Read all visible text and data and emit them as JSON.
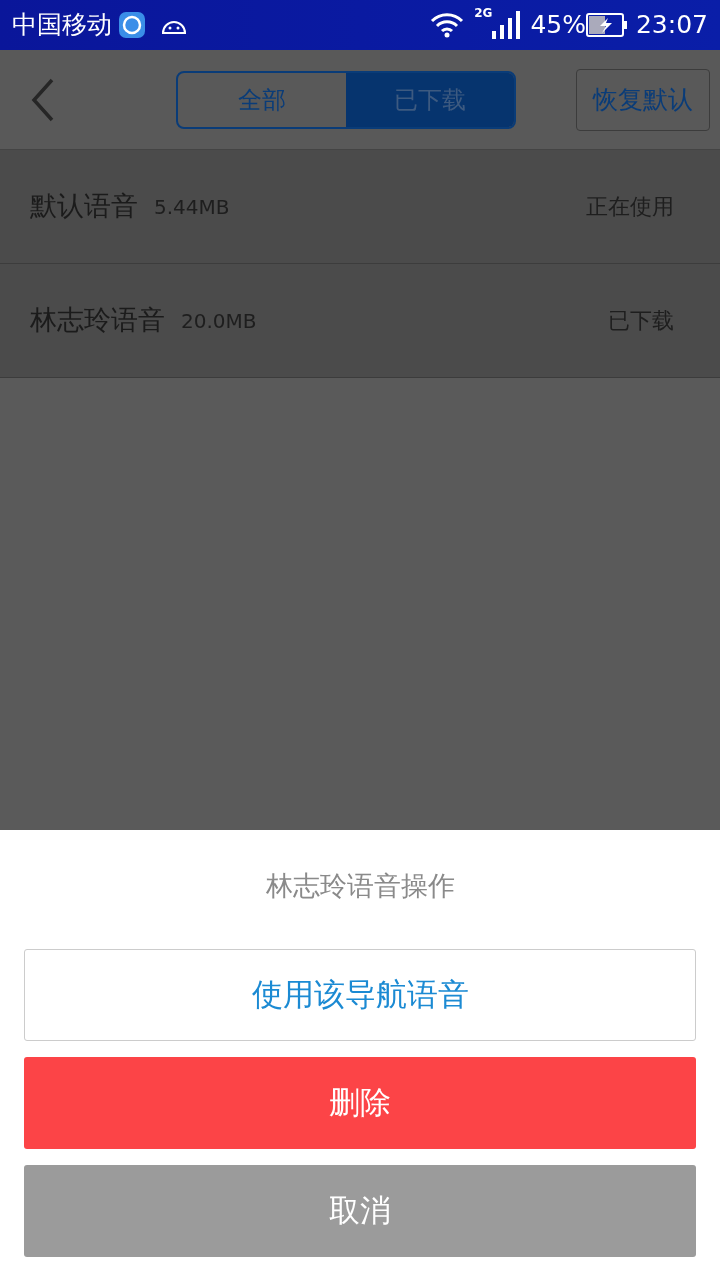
{
  "status_bar": {
    "carrier": "中国移动",
    "network": "2G",
    "battery": "45%",
    "time": "23:07"
  },
  "header": {
    "tabs": [
      {
        "label": "全部",
        "selected": false
      },
      {
        "label": "已下载",
        "selected": true
      }
    ],
    "reset_button": "恢复默认"
  },
  "voices": [
    {
      "name": "默认语音",
      "size": "5.44MB",
      "status": "正在使用"
    },
    {
      "name": "林志玲语音",
      "size": "20.0MB",
      "status": "已下载"
    }
  ],
  "action_sheet": {
    "title": "林志玲语音操作",
    "actions": [
      {
        "label": "使用该导航语音",
        "kind": "outline"
      },
      {
        "label": "删除",
        "kind": "danger"
      },
      {
        "label": "取消",
        "kind": "cancel"
      }
    ]
  }
}
